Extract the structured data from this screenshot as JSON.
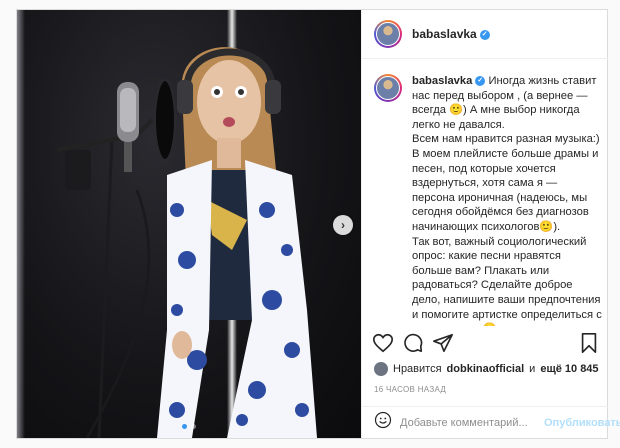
{
  "post": {
    "username": "babaslavka",
    "verified_mark": "✓",
    "caption_lines": [
      "Иногда жизнь ставит нас перед выбором , (а вернее — всегда 🙂) А мне выбор никогда легко не давался.",
      "Всем нам нравится разная музыка:) В моем плейлисте больше драмы и песен, под которые хочется вздернуться, хотя сама я — персона ироничная (надеюсь, мы сегодня обойдёмся без диагнозов начинающих психологов🙂).",
      "Так вот, важный социологический опрос: какие песни нравятся больше вам? Плакать или радоваться? Сделайте доброе дело, напишите ваши предпочтения и помогите артистке определиться с репертуаром 🙂 плюсик в карму"
    ]
  },
  "likes": {
    "prefix": "Нравится",
    "user": "dobkinaofficial",
    "middle": "и",
    "count": "ещё 10 845"
  },
  "timestamp": "16 ЧАСОВ НАЗАД",
  "comment_box": {
    "placeholder": "Добавьте комментарий...",
    "post_label": "Опубликовать"
  },
  "carousel": {
    "next_glyph": "›",
    "slides": 2,
    "active": 0
  },
  "colors": {
    "accent": "#3897f0",
    "post_disabled": "#b2dffc"
  }
}
